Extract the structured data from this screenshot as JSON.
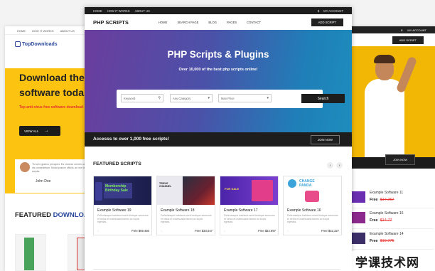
{
  "left_page": {
    "topbar": [
      "HOME",
      "HOW IT WORKS",
      "ABOUT US"
    ],
    "logo": "TopDownloads",
    "hero_line1": "Download the",
    "hero_line2": "software toda",
    "hero_sub": "Top anti-virus free software download",
    "view_all": "VIEW ALL",
    "testimonial_quote": "\"At vero graeco principes. Ea vivendo omnes nam, at vis consectetuer. Mutat possim officiis, an mei laudem scripta.",
    "testimonial_name": "John Doe",
    "featured_title_a": "FEATURED",
    "featured_title_b": "DOWNLOAD"
  },
  "right_page": {
    "topbar": [
      "$",
      "MY ACCOUNT"
    ],
    "add_script": "ADD SCRIPT",
    "join_now": "JOIN NOW",
    "items": [
      {
        "title": "Example Software 11",
        "price": "Free",
        "old": "$17.257",
        "color": "#6a2fb0"
      },
      {
        "title": "Example Software 16",
        "price": "Free",
        "old": "$14.77",
        "color": "#8b2a8c"
      },
      {
        "title": "Example Software 14",
        "price": "Free",
        "old": "$19.275",
        "color": "#3c2f68"
      }
    ]
  },
  "main_page": {
    "topbar_left": [
      "HOME",
      "HOW IT WORKS",
      "ABOUT US"
    ],
    "topbar_right": [
      "$",
      "MY ACCOUNT"
    ],
    "logo": "PHP SCRIPTS",
    "menu": [
      "HOME",
      "SEARCH PAGE",
      "BLOG",
      "PAGES",
      "CONTACT"
    ],
    "add_script": "ADD SCRIPT",
    "hero_title": "PHP Scripts & Plugins",
    "hero_sub": "Over 10,000 of the best php scripts online!",
    "search": {
      "keyword": "Keyword",
      "category": "Any Category",
      "price": "Max Price",
      "button": "Search"
    },
    "bar_text": "Accesss to over 1,000 free scripts!",
    "join_now": "JOIN NOW",
    "featured_title": "FEATURED SCRIPTS",
    "cards": [
      {
        "title": "Example Software 19",
        "desc": "Pellentesque habitant morbi tristique senectus et netus et malesuada fames ac turpis egestas.",
        "price": "Free $69.450",
        "img": "#2a2c6a"
      },
      {
        "title": "Example Software 18",
        "desc": "Pellentesque habitant morbi tristique senectus et netus et malesuada fames ac turpis egestas.",
        "price": "Free $33,047",
        "img": "#1f2531"
      },
      {
        "title": "Example Software 17",
        "desc": "Pellentesque habitant morbi tristique senectus et netus et malesuada fames ac turpis egestas.",
        "price": "Free $22.897",
        "img": "#4a24a8"
      },
      {
        "title": "Example Software 16",
        "desc": "Pellentesque habitant morbi tristique senectus et netus et malesuada fames ac turpis egestas.",
        "price": "Free $32,327",
        "img": "#ffffff"
      }
    ],
    "card_art": {
      "c1_text": "Membership Birthday Sale",
      "c2_text": "TRIPLE CHANNEL",
      "c3_text": "FOR SALE",
      "c4_text": "CHANGE PANDA"
    }
  },
  "watermark": "学课技术网"
}
